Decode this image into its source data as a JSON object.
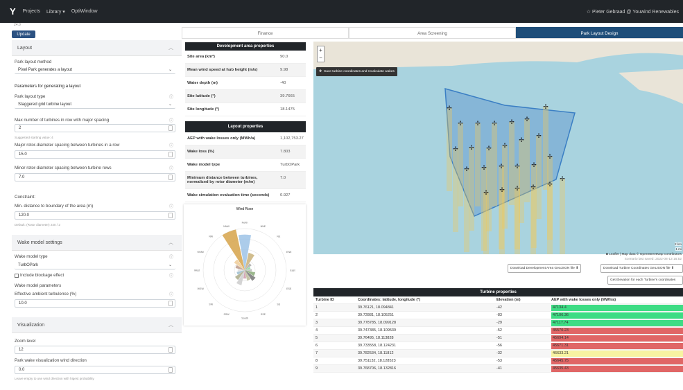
{
  "nav": {
    "links": [
      "Projects",
      "Library ▾",
      "OptiWindow"
    ],
    "user": "☆ Pieter Gebraad @ Youwind Renewables"
  },
  "sidebar": {
    "top_value": "24.0",
    "update_label": "Update",
    "layout_header": "Layout",
    "park_method_label": "Park layout method",
    "park_method_value": "Pixel Park generates a layout",
    "params_title": "Parameters for generating a layout",
    "park_type_label": "Park layout type",
    "park_type_value": "Staggered grid turbine layout",
    "max_turbines_label": "Max number of turbines in row with major spacing",
    "max_turbines_value": "2",
    "suggested": "Suggested starting value: 4",
    "major_label": "Major rotor-diameter spacing between turbines in a row",
    "major_value": "15.0",
    "minor_label": "Minor rotor-diameter spacing between turbine rows",
    "minor_value": "7.0",
    "constraint_label": "Constraint:",
    "min_dist_label": "Min. distance to boundary of the area (m)",
    "min_dist_value": "120.0",
    "default_note": "Default: (Rotor diameter) 240 / 2",
    "wake_header": "Wake model settings",
    "wake_type_label": "Wake model type",
    "wake_type_value": "TurbOPark",
    "blockage_label": "Include blockage effect",
    "wake_params_label": "Wake model parameters",
    "turbulence_label": "Effective ambient turbulence (%)",
    "turbulence_value": "10.0",
    "vis_header": "Visualization",
    "zoom_label": "Zoom level",
    "zoom_value": "12",
    "wind_dir_label": "Park wake visualization wind direction",
    "wind_dir_value": "0.0",
    "wind_dir_hint": "Leave empty to use wind direction with higest probability"
  },
  "tabs": [
    "Finance",
    "Area Screening",
    "Park Layout Design"
  ],
  "dev_props": {
    "title": "Development area properties",
    "rows": [
      [
        "Site area (km²)",
        "90.0"
      ],
      [
        "Mean wind speed at hub height (m/s)",
        "9.98"
      ],
      [
        "Water depth (m)",
        "-40"
      ],
      [
        "Site latitude (°)",
        "39.7665"
      ],
      [
        "Site longitude (°)",
        "18.1475"
      ]
    ]
  },
  "layout_props": {
    "title": "Layout properties",
    "rows": [
      [
        "AEP with wake losses only (MWh/a)",
        "1,102,753.27"
      ],
      [
        "Wake loss (%)",
        "7.803"
      ],
      [
        "Wake model type",
        "TurbOPark"
      ],
      [
        "Minimum distance between turbines, normalized by rotor diameter (m/m)",
        "7.0"
      ],
      [
        "Wake simulation evaluation time (seconds)",
        "0.927"
      ]
    ]
  },
  "wind_rose": {
    "title": "Wind Rose",
    "directions": [
      "North",
      "NNE",
      "NE",
      "ENE",
      "East",
      "ESE",
      "SE",
      "SSE",
      "South",
      "SSW",
      "SW",
      "WSW",
      "West",
      "WNW",
      "NW",
      "NNW"
    ],
    "values": [
      60,
      30,
      14,
      10,
      12,
      18,
      22,
      18,
      14,
      26,
      20,
      14,
      12,
      16,
      22,
      70
    ]
  },
  "map": {
    "save_label": "Save turbine coordinates and recalculate wakes",
    "attribution": "■ Leaflet | Map data © OpenStreetMap contributors",
    "last_saved": "Scenario last saved: 2022-08-13 16:52",
    "scale_top": "2 km",
    "scale_bottom": "1 mi"
  },
  "buttons": {
    "dl_area": "Download Development Area GeoJSON file ⬇",
    "dl_turbines": "Download Turbine Coordinates GeoJSON file ⬇",
    "elevation": "Get Elevation for each Turbine's coordinates"
  },
  "turbines": {
    "title": "Turbine properties",
    "headers": [
      "Turbine ID",
      "Coordinates: latitude, longitude (°)",
      "Elevation (m)",
      "AEP with wake losses only (MWh/a)"
    ],
    "rows": [
      [
        "1",
        "39.76121, 18.094841",
        "-42",
        "47134.4",
        "#3ddc84"
      ],
      [
        "2",
        "39.72881, 18.105251",
        "-83",
        "47106.36",
        "#3ddc84"
      ],
      [
        "3",
        "39.778785, 18.099128",
        "-29",
        "47117.74",
        "#3ddc84"
      ],
      [
        "4",
        "39.747385, 18.109539",
        "-52",
        "45570.23",
        "#e06666"
      ],
      [
        "5",
        "39.76495, 18.113828",
        "-51",
        "45694.14",
        "#e06666"
      ],
      [
        "6",
        "39.733558, 18.124231",
        "-56",
        "45671.31",
        "#e06666"
      ],
      [
        "7",
        "39.782534, 18.11812",
        "-32",
        "46633.21",
        "#f7f3a1"
      ],
      [
        "8",
        "39.751132, 18.128523",
        "-53",
        "45645.75",
        "#e06666"
      ],
      [
        "9",
        "39.768706, 18.132816",
        "-41",
        "45635.43",
        "#e06666"
      ]
    ]
  }
}
